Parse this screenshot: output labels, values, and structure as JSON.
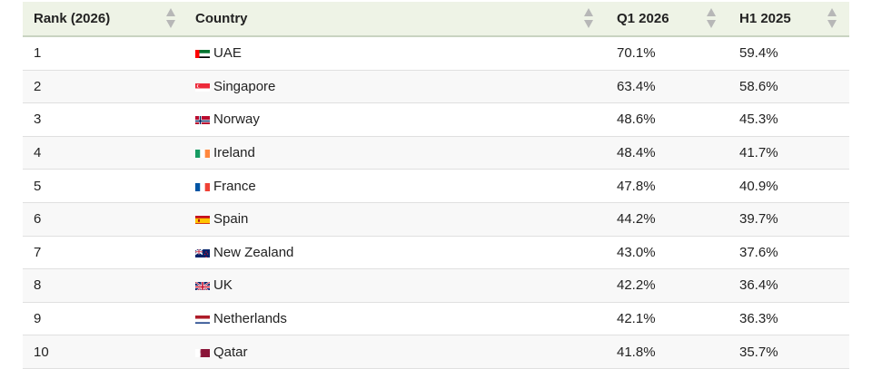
{
  "table": {
    "headers": [
      {
        "label": "Rank (2026)"
      },
      {
        "label": "Country"
      },
      {
        "label": "Q1 2026"
      },
      {
        "label": "H1 2025"
      }
    ],
    "rows": [
      {
        "rank": "1",
        "country": "UAE",
        "flag": "uae-flag",
        "q1_2026": "70.1%",
        "h1_2025": "59.4%"
      },
      {
        "rank": "2",
        "country": "Singapore",
        "flag": "singapore-flag",
        "q1_2026": "63.4%",
        "h1_2025": "58.6%"
      },
      {
        "rank": "3",
        "country": "Norway",
        "flag": "norway-flag",
        "q1_2026": "48.6%",
        "h1_2025": "45.3%"
      },
      {
        "rank": "4",
        "country": "Ireland",
        "flag": "ireland-flag",
        "q1_2026": "48.4%",
        "h1_2025": "41.7%"
      },
      {
        "rank": "5",
        "country": "France",
        "flag": "france-flag",
        "q1_2026": "47.8%",
        "h1_2025": "40.9%"
      },
      {
        "rank": "6",
        "country": "Spain",
        "flag": "spain-flag",
        "q1_2026": "44.2%",
        "h1_2025": "39.7%"
      },
      {
        "rank": "7",
        "country": "New Zealand",
        "flag": "new-zealand-flag",
        "q1_2026": "43.0%",
        "h1_2025": "37.6%"
      },
      {
        "rank": "8",
        "country": "UK",
        "flag": "uk-flag",
        "q1_2026": "42.2%",
        "h1_2025": "36.4%"
      },
      {
        "rank": "9",
        "country": "Netherlands",
        "flag": "netherlands-flag",
        "q1_2026": "42.1%",
        "h1_2025": "36.3%"
      },
      {
        "rank": "10",
        "country": "Qatar",
        "flag": "qatar-flag",
        "q1_2026": "41.8%",
        "h1_2025": "35.7%"
      }
    ]
  },
  "colors": {
    "header_bg": "#eef3e6",
    "sort_arrow": "#b7b7b7",
    "row_alt_bg": "#f8f8f8"
  }
}
